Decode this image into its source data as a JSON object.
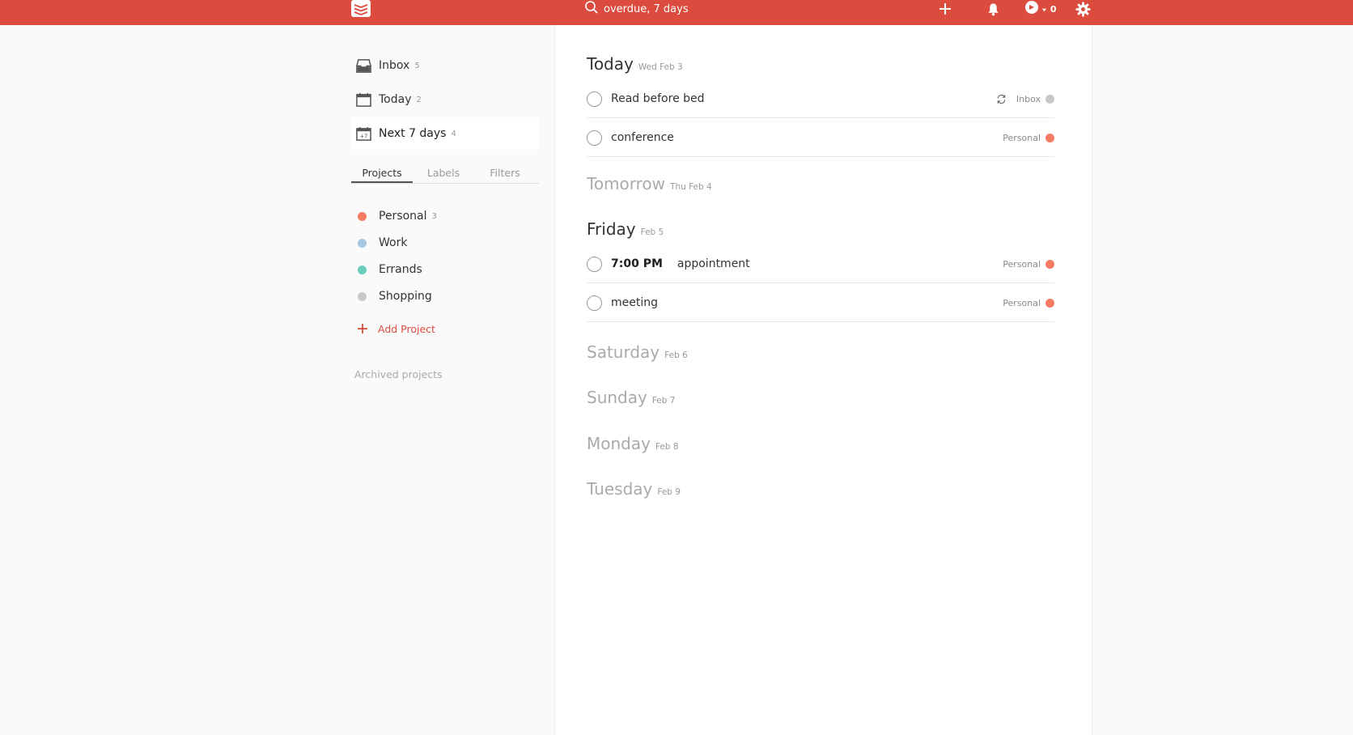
{
  "topbar": {
    "search_text": "overdue, 7 days",
    "karma_value": "0",
    "icons": [
      "logo-icon",
      "search-icon",
      "add-icon",
      "bell-icon",
      "karma-icon",
      "gear-icon"
    ]
  },
  "sidebar": {
    "nav": [
      {
        "label": "Inbox",
        "count": "5",
        "icon": "inbox-icon"
      },
      {
        "label": "Today",
        "count": "2",
        "icon": "calendar-icon"
      },
      {
        "label": "Next 7 days",
        "count": "4",
        "icon": "calendar-week-icon",
        "badge": "+7"
      }
    ],
    "tabs": [
      {
        "label": "Projects"
      },
      {
        "label": "Labels"
      },
      {
        "label": "Filters"
      }
    ],
    "projects": [
      {
        "label": "Personal",
        "count": "3",
        "color": "#f47b62"
      },
      {
        "label": "Work",
        "count": "",
        "color": "#a8c8e4"
      },
      {
        "label": "Errands",
        "count": "",
        "color": "#6accbc"
      },
      {
        "label": "Shopping",
        "count": "",
        "color": "#c8c8c8"
      }
    ],
    "add_project": "Add Project",
    "archived": "Archived projects"
  },
  "main": {
    "days": [
      {
        "name": "Today",
        "date": "Wed Feb 3"
      },
      {
        "name": "Tomorrow",
        "date": "Thu Feb 4"
      },
      {
        "name": "Friday",
        "date": "Feb 5"
      },
      {
        "name": "Saturday",
        "date": "Feb 6"
      },
      {
        "name": "Sunday",
        "date": "Feb 7"
      },
      {
        "name": "Monday",
        "date": "Feb 8"
      },
      {
        "name": "Tuesday",
        "date": "Feb 9"
      }
    ],
    "tasks": [
      {
        "content": "Read before bed",
        "time": "",
        "project": "Inbox",
        "color": "#c8c8c8",
        "recurring": true
      },
      {
        "content": "conference",
        "time": "",
        "project": "Personal",
        "color": "#f47b62",
        "recurring": false
      },
      {
        "content": "appointment",
        "time": "7:00 PM",
        "project": "Personal",
        "color": "#f47b62",
        "recurring": false
      },
      {
        "content": "meeting",
        "time": "",
        "project": "Personal",
        "color": "#f47b62",
        "recurring": false
      }
    ]
  },
  "colors": {
    "brand": "#db4c3f",
    "personal": "#f47b62",
    "work": "#a8c8e4",
    "errands": "#6accbc",
    "shopping": "#c8c8c8"
  }
}
